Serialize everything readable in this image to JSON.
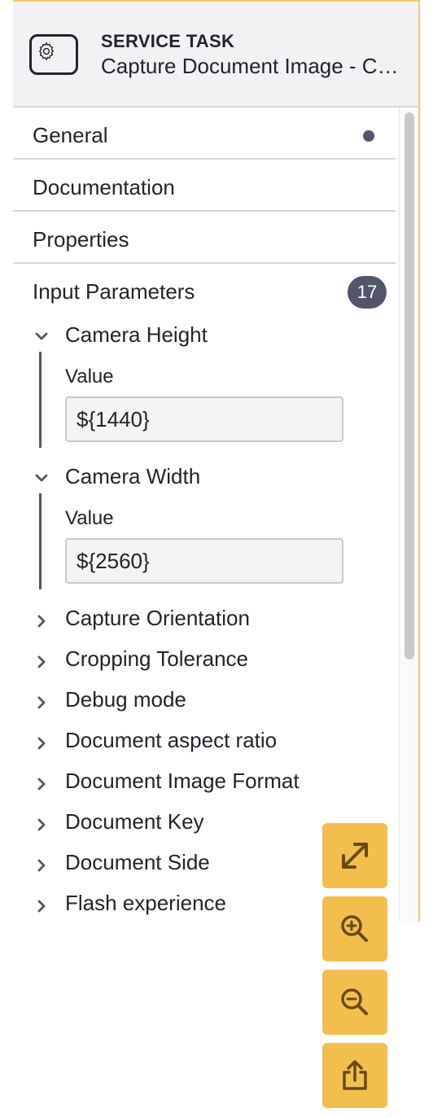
{
  "header": {
    "icon": "gear-icon",
    "kind": "SERVICE TASK",
    "name": "Capture Document Image - Camera"
  },
  "groups": [
    {
      "label": "General",
      "indicator": "dot"
    },
    {
      "label": "Documentation"
    },
    {
      "label": "Properties"
    },
    {
      "label": "Input Parameters",
      "badge": "17"
    }
  ],
  "parameters": [
    {
      "name": "Camera Height",
      "expanded": true,
      "field_label": "Value",
      "value": "${1440}"
    },
    {
      "name": "Camera Width",
      "expanded": true,
      "field_label": "Value",
      "value": "${2560}"
    },
    {
      "name": "Capture Orientation",
      "expanded": false
    },
    {
      "name": "Cropping Tolerance",
      "expanded": false
    },
    {
      "name": "Debug mode",
      "expanded": false
    },
    {
      "name": "Document aspect ratio",
      "expanded": false
    },
    {
      "name": "Document Image Format",
      "expanded": false
    },
    {
      "name": "Document Key",
      "expanded": false
    },
    {
      "name": "Document Side",
      "expanded": false
    },
    {
      "name": "Flash experience",
      "expanded": false
    }
  ],
  "canvas_controls": [
    {
      "name": "fit-viewport-icon"
    },
    {
      "name": "zoom-in-icon"
    },
    {
      "name": "zoom-out-icon"
    },
    {
      "name": "export-icon"
    }
  ],
  "colors": {
    "accent": "#f2bf4f",
    "panel_border": "#f5c471",
    "badge": "#52566b"
  }
}
